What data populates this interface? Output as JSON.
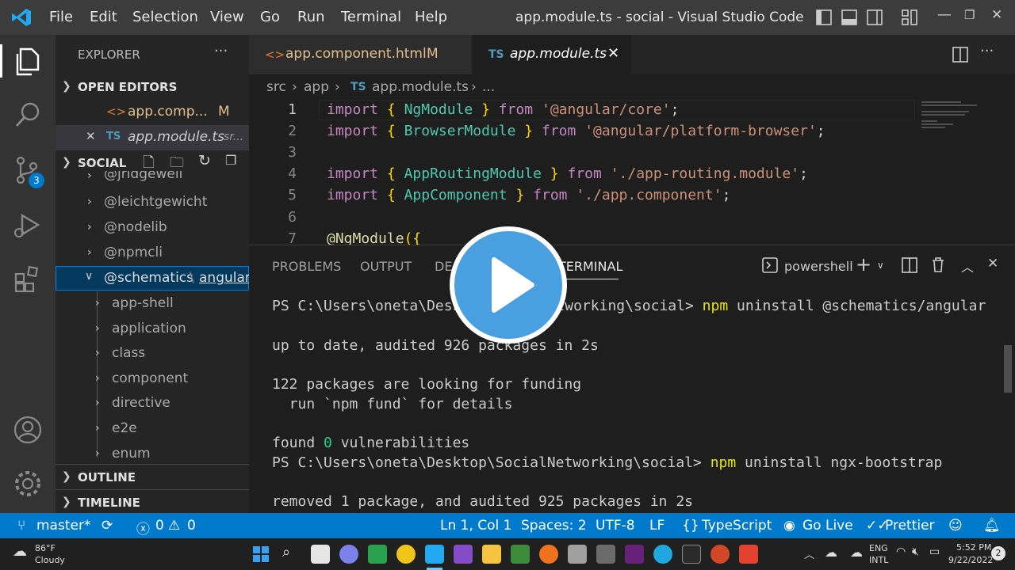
{
  "titlebar": {
    "menu": [
      "File",
      "Edit",
      "Selection",
      "View",
      "Go",
      "Run",
      "Terminal",
      "Help"
    ],
    "title": "app.module.ts - social - Visual Studio Code"
  },
  "activitybar": {
    "scm_badge": "3"
  },
  "sidebar": {
    "header": "EXPLORER",
    "more": "···",
    "open_editors": "OPEN EDITORS",
    "open_files": [
      {
        "name": "app.comp...",
        "badge": "M",
        "lang": "<>"
      },
      {
        "name": "app.module.ts",
        "detail": "sr...",
        "lang": "TS",
        "close": "✕"
      }
    ],
    "project": "SOCIAL",
    "tree": [
      "@jridgewell",
      "@leichtgewicht",
      "@nodelib",
      "@npmcli"
    ],
    "selected_folder": "@schematics",
    "selected_sub": "angular",
    "children": [
      "app-shell",
      "application",
      "class",
      "component",
      "directive",
      "e2e",
      "enum"
    ],
    "outline": "OUTLINE",
    "timeline": "TIMELINE"
  },
  "tabs": [
    {
      "name": "app.component.html",
      "badge": "M",
      "icon": "<>"
    },
    {
      "name": "app.module.ts",
      "icon": "TS",
      "close": "✕"
    }
  ],
  "breadcrumb": {
    "src": "src",
    "app": "app",
    "ts": "TS",
    "file": "app.module.ts",
    "more": "..."
  },
  "code_lines": [
    {
      "n": "1",
      "kw": "import",
      "b1": "{",
      "id": "NgModule",
      "b2": "}",
      "from": "from",
      "str": "'@angular/core'",
      "end": ";"
    },
    {
      "n": "2",
      "kw": "import",
      "b1": "{",
      "id": "BrowserModule",
      "b2": "}",
      "from": "from",
      "str": "'@angular/platform-browser'",
      "end": ";"
    },
    {
      "n": "3"
    },
    {
      "n": "4",
      "kw": "import",
      "b1": "{",
      "id": "AppRoutingModule",
      "b2": "}",
      "from": "from",
      "str": "'./app-routing.module'",
      "end": ";"
    },
    {
      "n": "5",
      "kw": "import",
      "b1": "{",
      "id": "AppComponent",
      "b2": "}",
      "from": "from",
      "str": "'./app.component'",
      "end": ";"
    },
    {
      "n": "6"
    },
    {
      "n": "7",
      "dec": "@NgModule",
      "rest": "({"
    }
  ],
  "panel": {
    "tabs": [
      "PROBLEMS",
      "OUTPUT",
      "DE",
      "TERMINAL"
    ],
    "shell": "powershell",
    "lines": [
      {
        "prompt": "PS C:\\Users\\oneta\\Desk",
        "prompt2": "tworking\\social> ",
        "cmd": "npm",
        "arg": " uninstall @schematics/angular"
      },
      {
        "text": ""
      },
      {
        "text": "up to date, audited 926 packages in 2s"
      },
      {
        "text": ""
      },
      {
        "text": "122 packages are looking for funding"
      },
      {
        "text": "  run `npm fund` for details"
      },
      {
        "text": ""
      },
      {
        "found": "found ",
        "zero": "0",
        "vuln": " vulnerabilities"
      },
      {
        "prompt": "PS C:\\Users\\oneta\\Desktop\\SocialNetworking\\social> ",
        "cmd": "npm",
        "arg": " uninstall ngx-bootstrap"
      },
      {
        "text": ""
      },
      {
        "text": "removed 1 package, and audited 925 packages in 2s"
      }
    ]
  },
  "statusbar": {
    "branch": "master*",
    "errors": "0",
    "warnings": "0",
    "position": "Ln 1, Col 1",
    "spaces": "Spaces: 2",
    "encoding": "UTF-8",
    "eol": "LF",
    "language": "TypeScript",
    "golive": "Go Live",
    "prettier": "Prettier"
  },
  "taskbar": {
    "temp": "86°F",
    "weather": "Cloudy",
    "lang": "ENG",
    "lang2": "INTL",
    "time": "5:52 PM",
    "date": "9/22/2022",
    "notif": "2"
  }
}
